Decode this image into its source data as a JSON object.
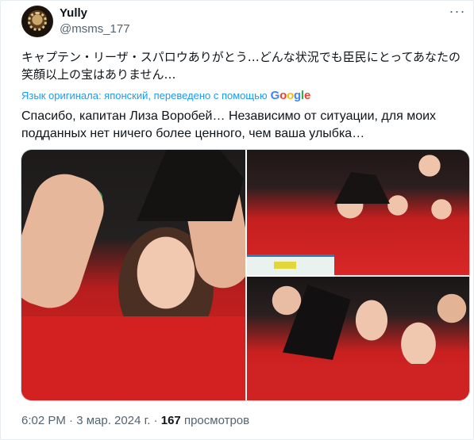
{
  "author": {
    "name": "Yully",
    "handle": "@msms_177"
  },
  "post": {
    "text_original": "キャプテン・リーザ・スパロウありがとう…どんな状況でも臣民にとってあなたの笑顔以上の宝はありません…",
    "translation_note": "Язык оригинала: японский, переведено с помощью",
    "translation_provider": {
      "G1": "G",
      "o1": "o",
      "o2": "o",
      "g": "g",
      "l": "l",
      "e": "e"
    },
    "text_translated": "Спасибо, капитан Лиза Воробей… Независимо от ситуации, для моих подданных нет ничего более ценного, чем ваша улыбка…"
  },
  "media": [
    {
      "alt": ""
    },
    {
      "alt": ""
    },
    {
      "alt": ""
    }
  ],
  "footer": {
    "time": "6:02 PM",
    "separator1": " · ",
    "date": "3 мар. 2024 г.",
    "separator2": " · ",
    "views": "167",
    "views_label": " просмотров"
  },
  "icons": {
    "more": "more-horizontal-icon"
  },
  "colors": {
    "link": "#1d9bf0",
    "secondary_text": "#536471",
    "primary_text": "#0f1419",
    "border": "#cfd9de"
  }
}
